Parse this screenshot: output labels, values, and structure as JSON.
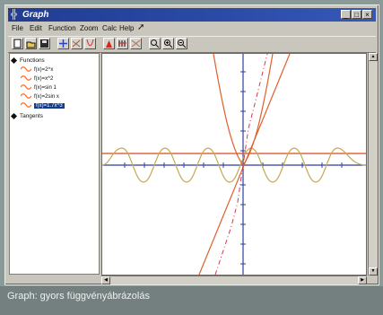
{
  "window": {
    "title": "Graph"
  },
  "menu": {
    "items": [
      "File",
      "Edit",
      "Function",
      "Zoom",
      "Calc",
      "Help"
    ]
  },
  "toolbar": {
    "buttons": [
      "new-icon",
      "open-icon",
      "save-icon",
      "axes-icon",
      "graph-icon",
      "insert-function-icon",
      "shade-icon",
      "table-icon",
      "regression-icon",
      "zoom-icon",
      "zoom-in-icon",
      "zoom-out-icon"
    ]
  },
  "sidebar": {
    "functions_label": "Functions",
    "tangents_label": "Tangents",
    "functions": [
      {
        "label": "f(x)=2^x",
        "color": "#ff6a13"
      },
      {
        "label": "f(x)=x^2",
        "color": "#ff6a13"
      },
      {
        "label": "f(x)=sin 1",
        "color": "#ff6a13"
      },
      {
        "label": "f(x)=2sin x",
        "color": "#ff6a13"
      },
      {
        "label": "f(x)=1.7x^3",
        "color": "#ff6a13"
      }
    ]
  },
  "caption": {
    "text": "Graph: gyors függvényábrázolás"
  },
  "colors": {
    "accent": "#ff6a13",
    "title_bar": "#213c92"
  }
}
